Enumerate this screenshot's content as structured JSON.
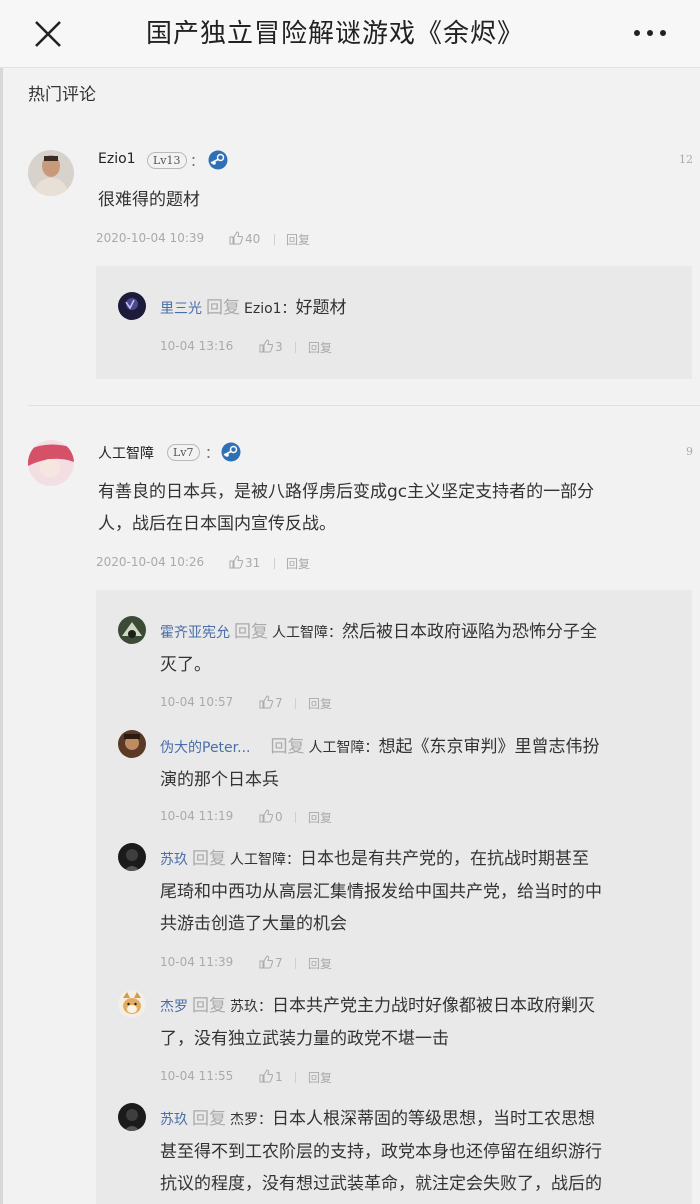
{
  "header": {
    "title": "国产独立冒险解谜游戏《余烬》",
    "close_icon": "close-icon",
    "more_icon": "more-dots-icon"
  },
  "section": {
    "title": "热门评论"
  },
  "comments": [
    {
      "user": "Ezio1",
      "level": "Lv13",
      "colon": "：",
      "floor": "12",
      "text": "很难得的题材",
      "date": "2020-10-04 10:39",
      "likes": "40",
      "reply_label": "回复",
      "replies": [
        {
          "user": "里三光",
          "reply_word": "回复",
          "target": "Ezio1：",
          "text_line1": "好题材",
          "date": "10-04 13:16",
          "likes": "3",
          "reply_label": "回复"
        }
      ]
    },
    {
      "user": "人工智障",
      "level": "Lv7",
      "colon": "：",
      "floor": "9",
      "text_line1": "有善良的日本兵，是被八路俘虏后变成gc主义坚定支持者的一部分",
      "text_line2": "人，战后在日本国内宣传反战。",
      "date": "2020-10-04 10:26",
      "likes": "31",
      "reply_label": "回复",
      "replies": [
        {
          "user": "霍齐亚宪允",
          "reply_word": "回复",
          "target": "人工智障：",
          "text_line1": "然后被日本政府诬陷为恐怖分子全",
          "text_line2": "灭了。",
          "date": "10-04 10:57",
          "likes": "7",
          "reply_label": "回复"
        },
        {
          "user": "伪大的Peter...",
          "reply_word": "回复",
          "target": "人工智障：",
          "text_line1": "想起《东京审判》里曾志伟扮",
          "text_line2": "演的那个日本兵",
          "date": "10-04 11:19",
          "likes": "0",
          "reply_label": "回复"
        },
        {
          "user": "苏玖",
          "reply_word": "回复",
          "target": "人工智障：",
          "text_line1": "日本也是有共产党的，在抗战时期甚至",
          "text_line2": "尾琦和中西功从高层汇集情报发给中国共产党，给当时的中",
          "text_line3": "共游击创造了大量的机会",
          "date": "10-04 11:39",
          "likes": "7",
          "reply_label": "回复"
        },
        {
          "user": "杰罗",
          "reply_word": "回复",
          "target": "苏玖：",
          "text_line1": "日本共产党主力战时好像都被日本政府剿灭",
          "text_line2": "了，没有独立武装力量的政党不堪一击",
          "date": "10-04 11:55",
          "likes": "1",
          "reply_label": "回复"
        },
        {
          "user": "苏玖",
          "reply_word": "回复",
          "target": "杰罗：",
          "text_line1": "日本人根深蒂固的等级思想，当时工农思想",
          "text_line2": "甚至得不到工农阶层的支持，政党本身也还停留在组织游行",
          "text_line3": "抗议的程度，没有想过武装革命，就注定会失败了，战后的"
        }
      ]
    }
  ],
  "colors": {
    "accent_name": "#4a6ea8",
    "background": "#f2f2f2",
    "reply_box": "#e9e9e9",
    "meta": "#aaaaaa"
  }
}
